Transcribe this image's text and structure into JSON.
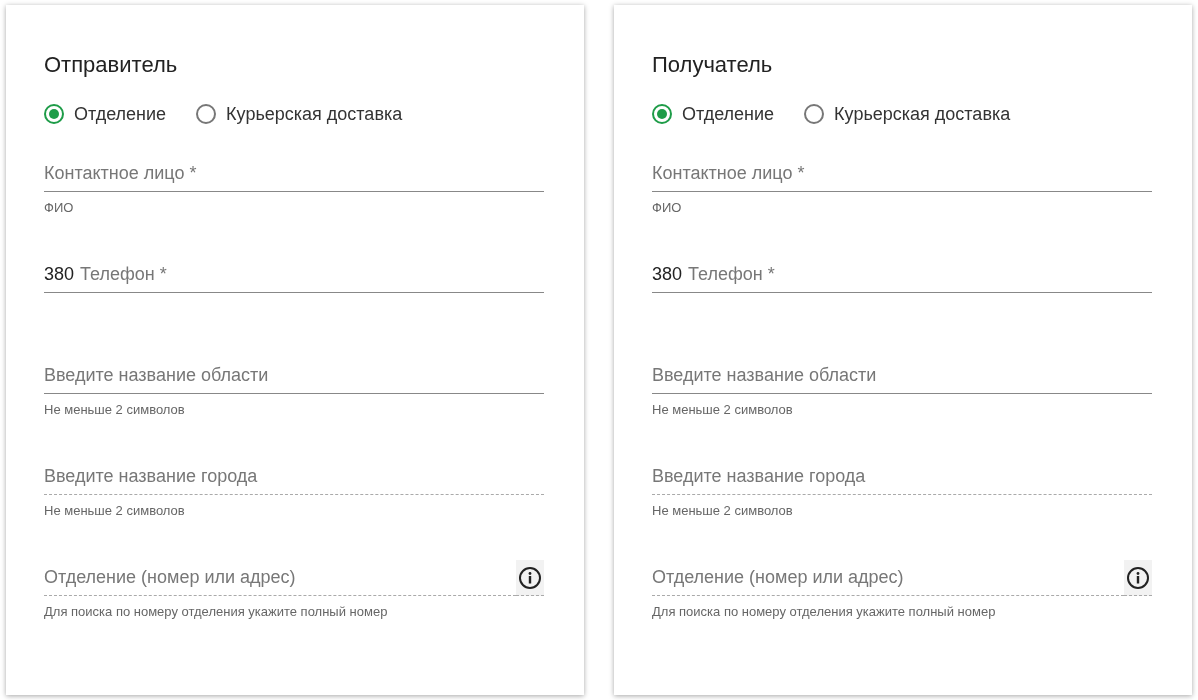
{
  "cards": [
    {
      "title": "Отправитель",
      "delivery": [
        {
          "label": "Отделение",
          "selected": true
        },
        {
          "label": "Курьерская доставка",
          "selected": false
        }
      ],
      "fields": [
        {
          "placeholder": "Контактное лицо *",
          "hint": "ФИО",
          "disabled": false
        },
        {
          "prefix": "380",
          "placeholder": "Телефон *",
          "disabled": false
        },
        {
          "placeholder": "Введите название области",
          "hint": "Не меньше 2 символов",
          "disabled": false
        },
        {
          "placeholder": "Введите название города",
          "hint": "Не меньше 2 символов",
          "disabled": true
        },
        {
          "placeholder": "Отделение (номер или адрес)",
          "hint": "Для поиска по номеру отделения укажите полный номер",
          "disabled": true,
          "info": true
        }
      ]
    },
    {
      "title": "Получатель",
      "delivery": [
        {
          "label": "Отделение",
          "selected": true
        },
        {
          "label": "Курьерская доставка",
          "selected": false
        }
      ],
      "fields": [
        {
          "placeholder": "Контактное лицо *",
          "hint": "ФИО",
          "disabled": false
        },
        {
          "prefix": "380",
          "placeholder": "Телефон *",
          "disabled": false
        },
        {
          "placeholder": "Введите название области",
          "hint": "Не меньше 2 символов",
          "disabled": false
        },
        {
          "placeholder": "Введите название города",
          "hint": "Не меньше 2 символов",
          "disabled": true
        },
        {
          "placeholder": "Отделение (номер или адрес)",
          "hint": "Для поиска по номеру отделения укажите полный номер",
          "disabled": true,
          "info": true
        }
      ]
    }
  ]
}
